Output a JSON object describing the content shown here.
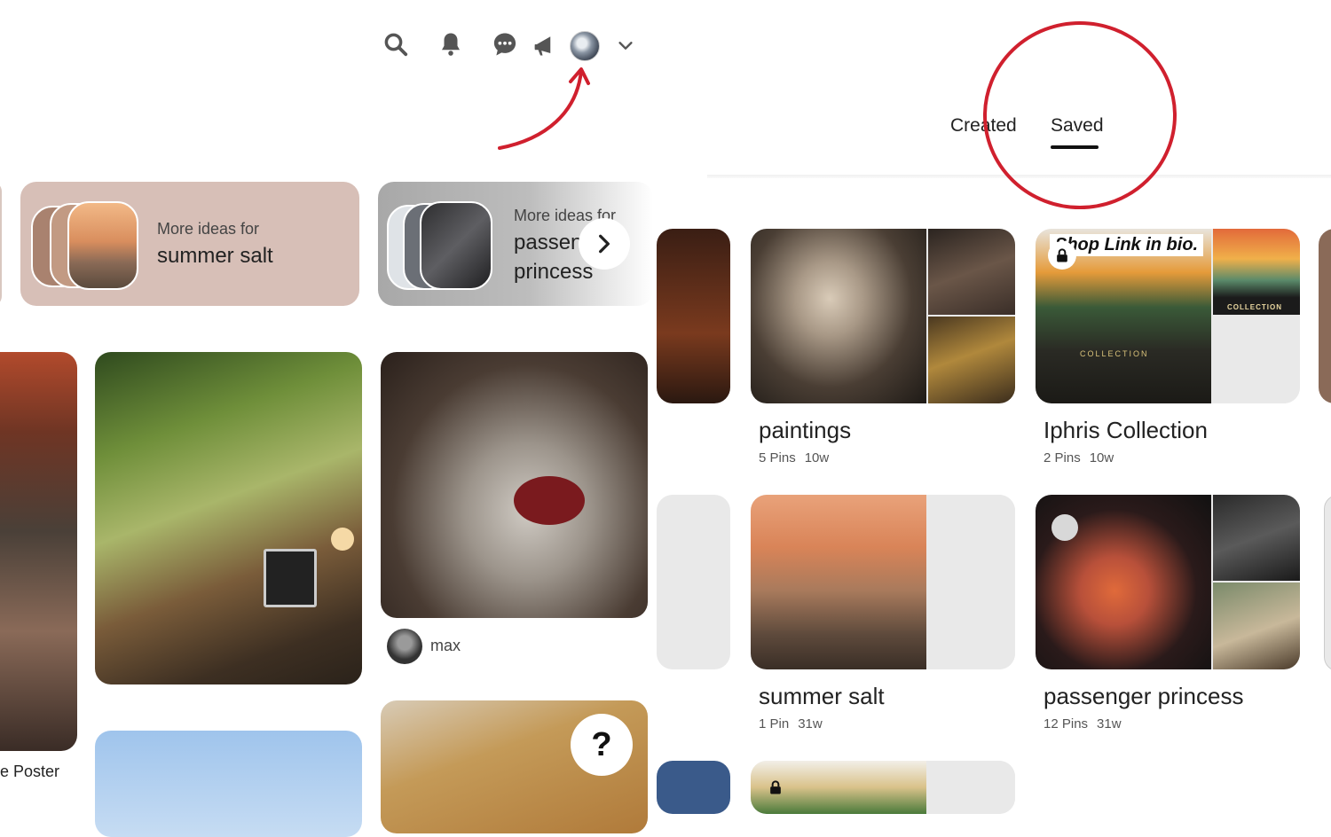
{
  "header": {
    "icons": [
      "search-icon",
      "bell-icon",
      "chat-icon",
      "megaphone-icon",
      "avatar",
      "chevron-down-icon"
    ]
  },
  "more_ideas": [
    {
      "prefix": "More ideas for",
      "board": "summer salt"
    },
    {
      "prefix": "More ideas for",
      "board": "passenger princess"
    }
  ],
  "feed": {
    "pin_user": "max",
    "left_caption": "e Poster",
    "help_symbol": "?"
  },
  "profile_tabs": {
    "created": "Created",
    "saved": "Saved"
  },
  "boards": [
    {
      "title": "paintings",
      "pins": "5 Pins",
      "age": "10w"
    },
    {
      "title": "Iphris Collection",
      "pins": "2 Pins",
      "age": "10w",
      "overlay_text": "Shop Link in bio.",
      "badge_text": "COLLECTION",
      "inner_text": "COLLECTION"
    },
    {
      "title": "summer salt",
      "pins": "1 Pin",
      "age": "31w"
    },
    {
      "title": "passenger princess",
      "pins": "12 Pins",
      "age": "31w"
    }
  ],
  "annotation_colors": {
    "accent": "#d0202e"
  }
}
